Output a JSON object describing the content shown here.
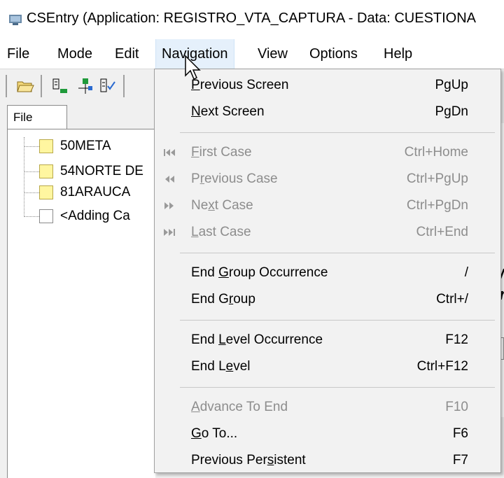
{
  "window": {
    "title": "CSEntry (Application: REGISTRO_VTA_CAPTURA - Data: CUESTIONA"
  },
  "menubar": {
    "items": [
      "File",
      "Mode",
      "Edit",
      "Navigation",
      "View",
      "Options",
      "Help"
    ],
    "active": "Navigation"
  },
  "tree": {
    "tab_label": "File",
    "items": [
      {
        "label": "50META",
        "kind": "folder"
      },
      {
        "label": "54NORTE DE",
        "kind": "folder"
      },
      {
        "label": "81ARAUCA",
        "kind": "folder"
      },
      {
        "label": "<Adding Ca",
        "kind": "blank"
      }
    ]
  },
  "right_fragments": [
    "d/",
    "or",
    "I"
  ],
  "navigation_menu": {
    "groups": [
      [
        {
          "pre": "",
          "u": "P",
          "post": "revious Screen",
          "shortcut": "PgUp",
          "enabled": true,
          "icon": ""
        },
        {
          "pre": "",
          "u": "N",
          "post": "ext Screen",
          "shortcut": "PgDn",
          "enabled": true,
          "icon": ""
        }
      ],
      [
        {
          "pre": "",
          "u": "F",
          "post": "irst Case",
          "shortcut": "Ctrl+Home",
          "enabled": false,
          "icon": "first-case-icon"
        },
        {
          "pre": "P",
          "u": "r",
          "post": "evious Case",
          "shortcut": "Ctrl+PgUp",
          "enabled": false,
          "icon": "previous-case-icon"
        },
        {
          "pre": "Ne",
          "u": "x",
          "post": "t Case",
          "shortcut": "Ctrl+PgDn",
          "enabled": false,
          "icon": "next-case-icon"
        },
        {
          "pre": "",
          "u": "L",
          "post": "ast Case",
          "shortcut": "Ctrl+End",
          "enabled": false,
          "icon": "last-case-icon"
        }
      ],
      [
        {
          "pre": "End ",
          "u": "G",
          "post": "roup Occurrence",
          "shortcut": "/",
          "enabled": true,
          "icon": ""
        },
        {
          "pre": "End G",
          "u": "r",
          "post": "oup",
          "shortcut": "Ctrl+/",
          "enabled": true,
          "icon": ""
        }
      ],
      [
        {
          "pre": "End ",
          "u": "L",
          "post": "evel Occurrence",
          "shortcut": "F12",
          "enabled": true,
          "icon": ""
        },
        {
          "pre": "End L",
          "u": "e",
          "post": "vel",
          "shortcut": "Ctrl+F12",
          "enabled": true,
          "icon": ""
        }
      ],
      [
        {
          "pre": "",
          "u": "A",
          "post": "dvance To End",
          "shortcut": "F10",
          "enabled": false,
          "icon": ""
        },
        {
          "pre": "",
          "u": "G",
          "post": "o To...",
          "shortcut": "F6",
          "enabled": true,
          "icon": ""
        },
        {
          "pre": "Previous Per",
          "u": "s",
          "post": "istent",
          "shortcut": "F7",
          "enabled": true,
          "icon": ""
        }
      ]
    ]
  },
  "colors": {
    "menu_bg": "#f2f2f2",
    "disabled_text": "#8d8d8d",
    "active_menu_bg": "#e5f0fb",
    "folder": "#fff6a0",
    "accent_magenta": "#c030c0"
  }
}
